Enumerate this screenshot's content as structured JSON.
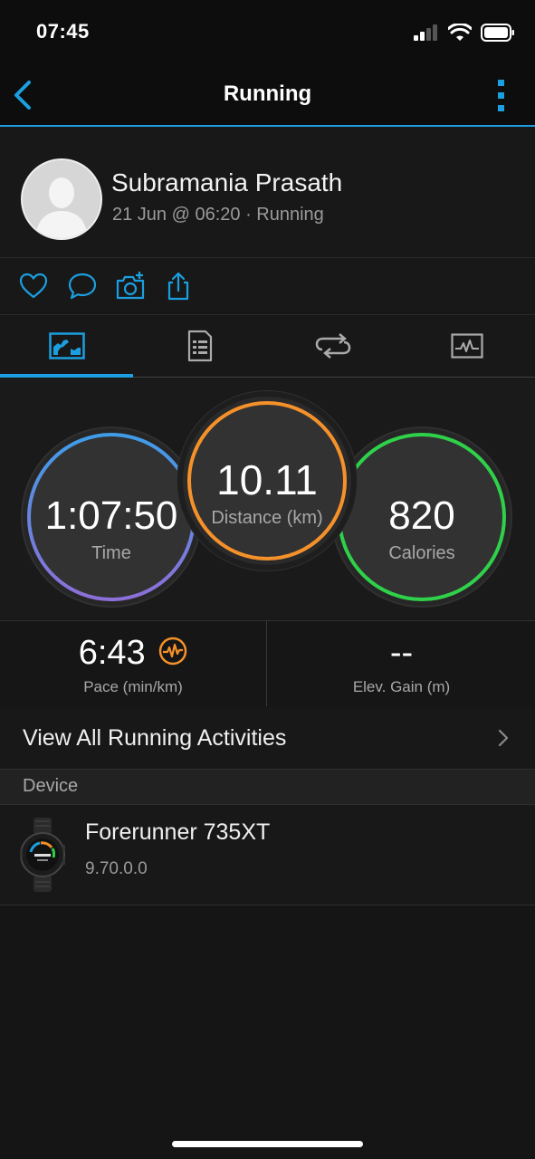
{
  "status_bar": {
    "time": "07:45",
    "icons": [
      "signal-icon",
      "wifi-icon",
      "battery-icon"
    ]
  },
  "nav": {
    "title": "Running",
    "back_icon": "chevron-left-icon",
    "more_icon": "more-vertical-icon",
    "accent": "#1b9fe0"
  },
  "profile": {
    "name": "Subramania Prasath",
    "meta": "21 Jun @ 06:20 · Running"
  },
  "actions": [
    "heart-icon",
    "comment-icon",
    "camera-add-icon",
    "share-icon"
  ],
  "tabs": [
    {
      "icon": "overview-chart-icon",
      "selected": true
    },
    {
      "icon": "details-list-icon",
      "selected": false
    },
    {
      "icon": "laps-loop-icon",
      "selected": false
    },
    {
      "icon": "graph-icon",
      "selected": false
    }
  ],
  "circles": {
    "time": {
      "value": "1:07:50",
      "label": "Time",
      "colors": [
        "#3f9de8",
        "#8d6fd8"
      ]
    },
    "distance": {
      "value": "10.11",
      "label": "Distance (km)",
      "color": "#f5912a"
    },
    "calories": {
      "value": "820",
      "label": "Calories",
      "color": "#2fd14a"
    }
  },
  "stats": {
    "pace": {
      "value": "6:43",
      "label": "Pace (min/km)",
      "icon": "pace-wave-icon",
      "icon_color": "#f5912a"
    },
    "elevation": {
      "value": "--",
      "label": "Elev. Gain (m)"
    }
  },
  "view_all": {
    "label": "View All Running Activities"
  },
  "device_section": {
    "header": "Device"
  },
  "device": {
    "name": "Forerunner 735XT",
    "version": "9.70.0.0"
  }
}
